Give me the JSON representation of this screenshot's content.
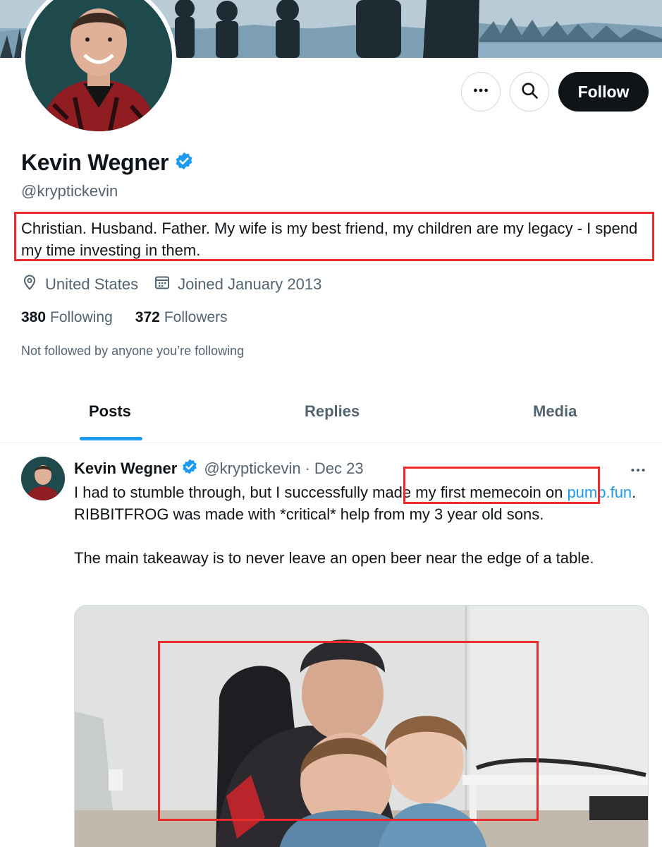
{
  "header": {
    "more_label": "More",
    "search_label": "Search",
    "follow_label": "Follow"
  },
  "profile": {
    "name": "Kevin Wegner",
    "handle": "@kryptickevin",
    "bio": "Christian. Husband. Father. My wife is my best friend, my children are my legacy - I spend my time investing in them.",
    "location": "United States",
    "joined": "Joined January 2013",
    "following_count": "380",
    "following_label": "Following",
    "followers_count": "372",
    "followers_label": "Followers",
    "not_followed": "Not followed by anyone you’re following"
  },
  "tabs": [
    {
      "label": "Posts",
      "active": true
    },
    {
      "label": "Replies",
      "active": false
    },
    {
      "label": "Media",
      "active": false
    }
  ],
  "post": {
    "name": "Kevin Wegner",
    "handle": "@kryptickevin",
    "separator": "·",
    "date": "Dec 23",
    "text_part1": "I had to stumble through, but I successfully made my first memecoin on ",
    "link": "pump.fun",
    "text_part2": ". RIBBITFROG was made with *critical* help from my 3 year old sons.",
    "text_para2": "The main takeaway is to never leave an open beer near the edge of a table."
  },
  "colors": {
    "accent": "#1d9bf0",
    "annotation": "#ee2b2b",
    "text_primary": "#0f1419",
    "text_secondary": "#536471",
    "follow_button": "#0f1419"
  },
  "icons": [
    "more-horizontal-icon",
    "search-icon",
    "verified-badge-icon",
    "location-pin-icon",
    "calendar-icon"
  ]
}
